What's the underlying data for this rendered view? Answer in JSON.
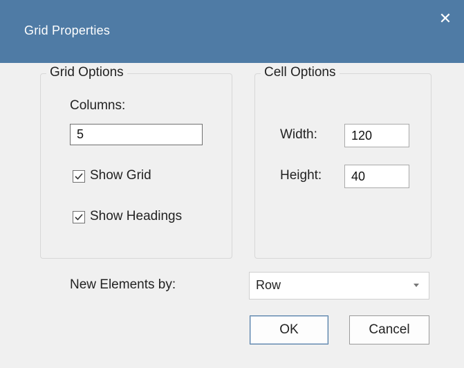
{
  "window": {
    "title": "Grid Properties",
    "close_glyph": "✕",
    "close_icon": "close-icon"
  },
  "grid_options": {
    "legend": "Grid Options",
    "columns_label": "Columns:",
    "columns_value": "5",
    "show_grid_label": "Show Grid",
    "show_grid_checked": true,
    "show_headings_label": "Show Headings",
    "show_headings_checked": true
  },
  "cell_options": {
    "legend": "Cell Options",
    "width_label": "Width:",
    "width_value": "120",
    "height_label": "Height:",
    "height_value": "40"
  },
  "new_elements": {
    "label": "New Elements by:",
    "selected": "Row"
  },
  "buttons": {
    "ok": "OK",
    "cancel": "Cancel"
  },
  "colors": {
    "titlebar": "#4f7ba5",
    "background": "#f0f0f0"
  }
}
